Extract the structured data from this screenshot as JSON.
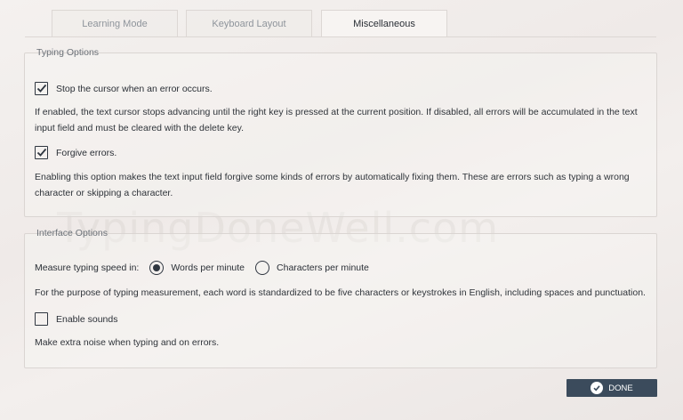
{
  "tabs": [
    {
      "label": "Learning Mode",
      "active": false
    },
    {
      "label": "Keyboard Layout",
      "active": false
    },
    {
      "label": "Miscellaneous",
      "active": true
    }
  ],
  "typing_options": {
    "legend": "Typing Options",
    "stop_cursor": {
      "label": "Stop the cursor when an error occurs.",
      "checked": true
    },
    "stop_cursor_desc": "If enabled, the text cursor stops advancing until the right key is pressed at the current position. If disabled, all errors will be accumulated in the text input field and must be cleared with the delete key.",
    "forgive": {
      "label": "Forgive errors.",
      "checked": true
    },
    "forgive_desc": "Enabling this option makes the text input field forgive some kinds of errors by automatically fixing them. These are errors such as typing a wrong character or skipping a character."
  },
  "interface_options": {
    "legend": "Interface Options",
    "speed_label": "Measure typing speed in:",
    "speed_options": [
      {
        "label": "Words per minute",
        "selected": true
      },
      {
        "label": "Characters per minute",
        "selected": false
      }
    ],
    "speed_desc": "For the purpose of typing measurement, each word is standardized to be five characters or keystrokes in English, including spaces and punctuation.",
    "sounds": {
      "label": "Enable sounds",
      "checked": false
    },
    "sounds_desc": "Make extra noise when typing and on errors."
  },
  "watermark": "TypingDoneWell.com",
  "done_button": {
    "label": "DONE",
    "icon": "check-circle-icon"
  },
  "colors": {
    "button_bg": "#3b4b5c",
    "text": "#2a2f36",
    "muted": "#8e949b"
  }
}
